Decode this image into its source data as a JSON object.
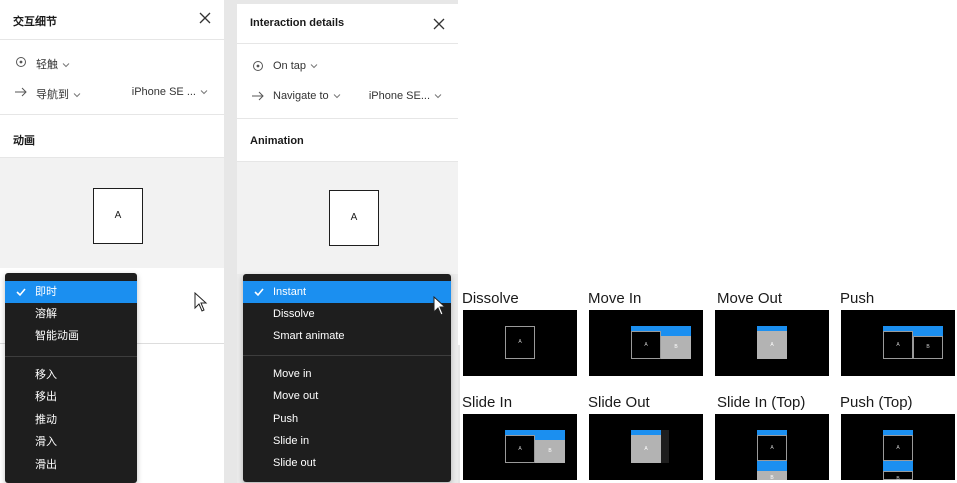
{
  "zh_panel": {
    "title": "交互细节",
    "trigger": "轻触",
    "action": "导航到",
    "destination": "iPhone SE ...",
    "animation_section": "动画",
    "preview_frame": "A",
    "menu": {
      "selected": "即时",
      "group1": [
        "溶解",
        "智能动画"
      ],
      "group2": [
        "移入",
        "移出",
        "推动",
        "滑入",
        "滑出"
      ]
    }
  },
  "en_panel": {
    "title": "Interaction details",
    "trigger": "On tap",
    "action": "Navigate to",
    "destination": "iPhone SE...",
    "animation_section": "Animation",
    "preview_frame": "A",
    "menu": {
      "selected": "Instant",
      "group1": [
        "Dissolve",
        "Smart animate"
      ],
      "group2": [
        "Move in",
        "Move out",
        "Push",
        "Slide in",
        "Slide out"
      ]
    }
  },
  "thumbnails": [
    {
      "label": "Dissolve",
      "a": "A"
    },
    {
      "label": "Move In",
      "a": "A",
      "b": "B"
    },
    {
      "label": "Move Out",
      "a": "A"
    },
    {
      "label": "Push",
      "a": "A",
      "b": "B"
    },
    {
      "label": "Slide In",
      "a": "A",
      "b": "B"
    },
    {
      "label": "Slide Out",
      "a": "A"
    },
    {
      "label": "Slide In (Top)",
      "a": "A",
      "b": "B"
    },
    {
      "label": "Push (Top)",
      "a": "A",
      "b": "B"
    }
  ],
  "colors": {
    "accent": "#1b8ff0",
    "menu_bg": "#1e1e1e",
    "preview_bg": "#f2f2f2",
    "thumb_bg": "#000000"
  },
  "icons": {
    "close": "close-icon",
    "trigger": "tap-target-icon",
    "action": "arrow-right-icon",
    "dropdown": "chevron-down-icon",
    "check": "check-icon",
    "pointer": "mouse-pointer-icon"
  }
}
